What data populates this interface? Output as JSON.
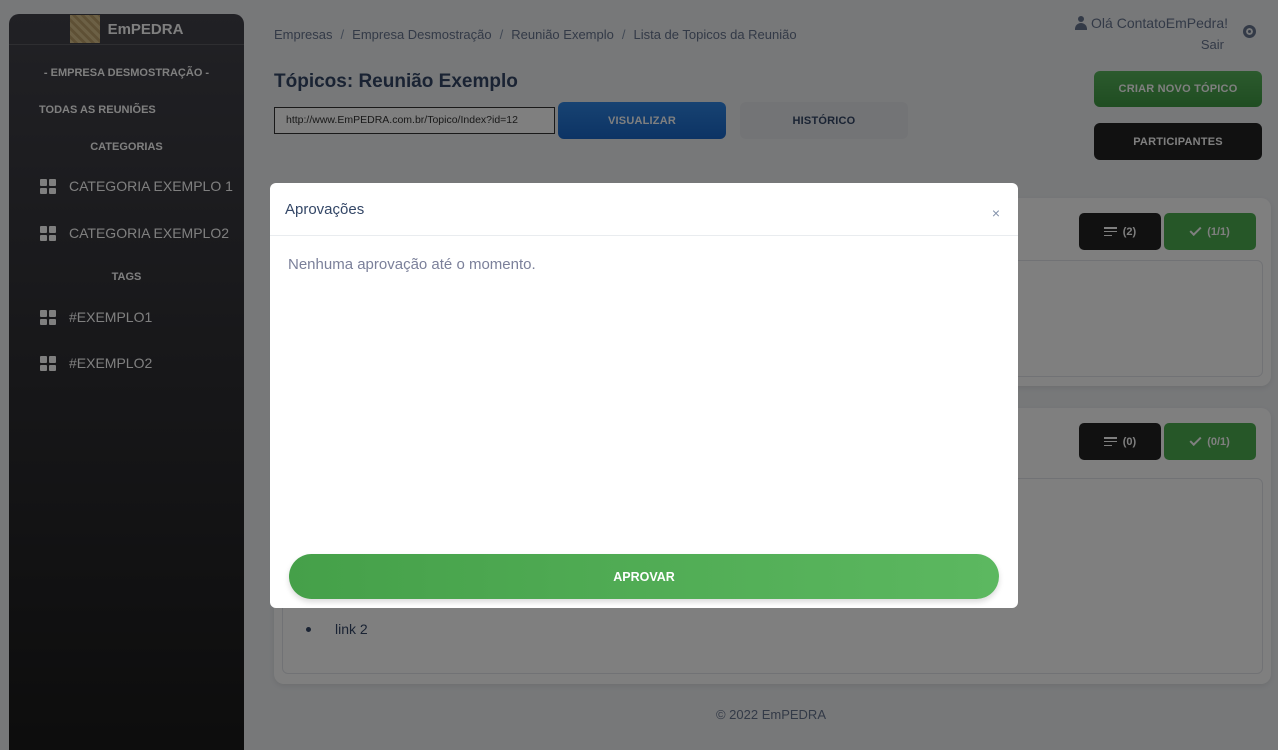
{
  "brand": {
    "name": "EmPEDRA"
  },
  "sidebar": {
    "company": "- EMPRESA DESMOSTRAÇÃO -",
    "all_meetings": "TODAS AS REUNIÕES",
    "categories_heading": "CATEGORIAS",
    "categories": [
      {
        "label": "CATEGORIA EXEMPLO 1",
        "icon": "dashboard-icon"
      },
      {
        "label": "CATEGORIA EXEMPLO2",
        "icon": "dashboard-icon"
      }
    ],
    "tags_heading": "TAGS",
    "tags": [
      {
        "label": "#EXEMPLO1",
        "icon": "dashboard-icon"
      },
      {
        "label": "#EXEMPLO2",
        "icon": "dashboard-icon"
      }
    ]
  },
  "breadcrumb": [
    "Empresas",
    "Empresa Desmostração",
    "Reunião Exemplo",
    "Lista de Topicos da Reunião"
  ],
  "user": {
    "greeting": "Olá ContatoEmPedra!",
    "logout": "Sair"
  },
  "page": {
    "title": "Tópicos: Reunião Exemplo",
    "url": "http://www.EmPEDRA.com.br/Topico/Index?id=12",
    "view_button": "VISUALIZAR",
    "history_button": "HISTÓRICO",
    "create_topic_button": "CRIAR NOVO TÓPICO",
    "participants_button": "PARTICIPANTES"
  },
  "topics": [
    {
      "comments": "(2)",
      "approvals": "(1/1)"
    },
    {
      "comments": "(0)",
      "approvals": "(0/1)",
      "link": "link 2"
    }
  ],
  "footer": "© 2022 EmPEDRA",
  "modal": {
    "title": "Aprovações",
    "close": "×",
    "message": "Nenhuma aprovação até o momento.",
    "approve_button": "APROVAR"
  },
  "colors": {
    "primary": "#1a73e8",
    "success": "#4caf50",
    "dark": "#222222"
  }
}
